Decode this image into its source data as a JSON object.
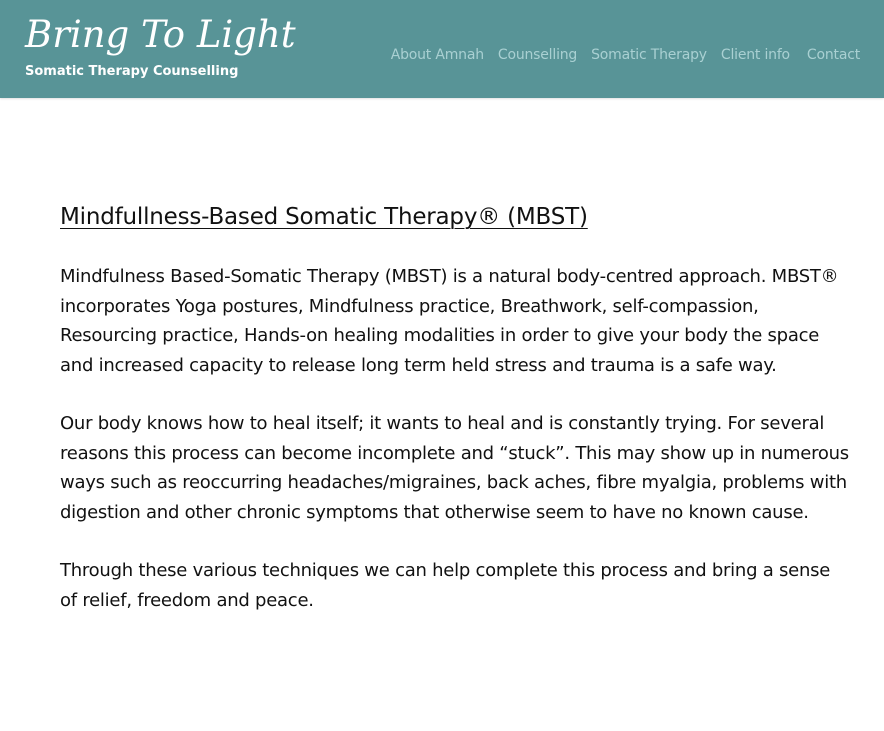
{
  "header": {
    "brand_title": "Bring To Light",
    "brand_subtitle": "Somatic Therapy Counselling",
    "background_color": "#589497",
    "nav": [
      {
        "label": "About Amnah"
      },
      {
        "label": "Counselling"
      },
      {
        "label": "Somatic Therapy"
      },
      {
        "label": "Client info"
      },
      {
        "label": "Contact"
      }
    ]
  },
  "main": {
    "title": "Mindfullness-Based Somatic  Therapy® (MBST)",
    "paragraphs": [
      "Mindfulness Based-Somatic Therapy (MBST) is a natural body-centred approach. MBST® incorporates Yoga postures, Mindfulness practice, Breathwork, self-compassion, Resourcing practice, Hands-on healing modalities in order to give your body the space and increased capacity to release long term held stress and trauma is a safe way.",
      "Our body knows how to heal itself; it wants to heal and is constantly trying. For several reasons this process can become incomplete and “stuck”. This may show up in numerous ways such as reoccurring headaches/migraines, back aches, fibre myalgia, problems with digestion and other chronic symptoms that otherwise seem to have no known cause.",
      "Through these various techniques we can help complete this process and bring a sense of relief, freedom and peace."
    ]
  }
}
